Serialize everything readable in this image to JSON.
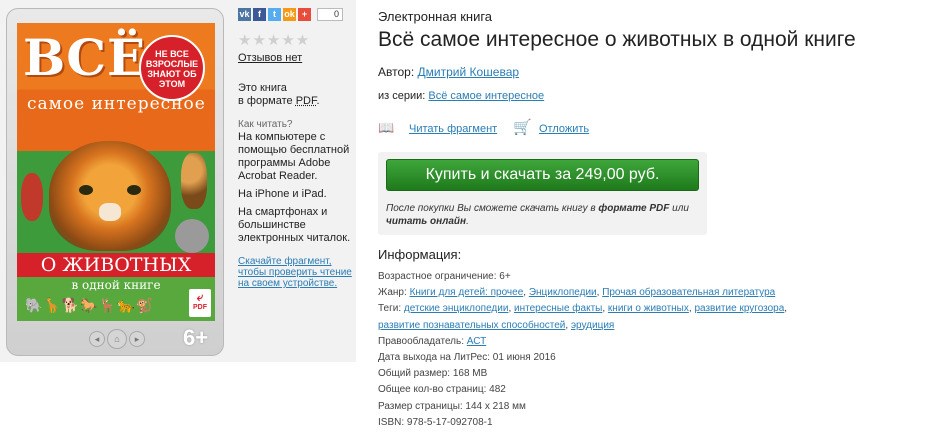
{
  "cover": {
    "title_big": "ВСЁ",
    "title_small": "самое интересное",
    "badge": "НЕ ВСЕ ВЗРОСЛЫЕ ЗНАЮТ ОБ ЭТОМ",
    "red_bar": "О ЖИВОТНЫХ",
    "sub_line": "в одной книге",
    "age_rating": "6+",
    "pdf_label": "PDF"
  },
  "share": {
    "icons": [
      "vk-icon",
      "facebook-icon",
      "twitter-icon",
      "odnoklassniki-icon",
      "plus-icon"
    ],
    "colors": [
      "#4c75a3",
      "#3b5998",
      "#55acee",
      "#f59a16",
      "#e74c3c"
    ],
    "letters": [
      "vk",
      "f",
      "t",
      "ok",
      "+"
    ],
    "count": "0"
  },
  "rating": {
    "stars": "★★★★★",
    "reviews": "Отзывов нет"
  },
  "format": {
    "line1": "Это книга",
    "line2_prefix": "в формате ",
    "line2_pdf": "PDF",
    "line2_suffix": "."
  },
  "howto": {
    "label": "Как читать?",
    "items": [
      "На компьютере с помощью бесплатной программы Adobe Acrobat Reader.",
      "На iPhone и iPad.",
      "На смартфонах и большинстве электронных читалок."
    ],
    "fragment_link": "Скачайте фрагмент, чтобы проверить чтение на своем устройстве."
  },
  "book": {
    "type": "Электронная книга",
    "title": "Всё самое интересное о животных в одной книге",
    "author_label": "Автор: ",
    "author": "Дмитрий Кошевар",
    "series_label": "из серии: ",
    "series": "Всё самое интересное"
  },
  "actions": {
    "read": "Читать фрагмент",
    "defer": "Отложить"
  },
  "buy": {
    "button": "Купить и скачать за 249,00 руб.",
    "note_prefix": "После покупки Вы сможете скачать книгу в ",
    "note_bold1": "формате PDF",
    "note_mid": " или ",
    "note_bold2": "читать онлайн",
    "note_suffix": "."
  },
  "info": {
    "title": "Информация:",
    "age_label": "Возрастное ограничение: ",
    "age": "6+",
    "genre_label": "Жанр: ",
    "genres": [
      "Книги для детей: прочее",
      "Энциклопедии",
      "Прочая образовательная литература"
    ],
    "tags_label": "Теги: ",
    "tags": [
      "детские энциклопедии",
      "интересные факты",
      "книги о животных",
      "развитие кругозора",
      "развитие познавательных способностей",
      "эрудиция"
    ],
    "rights_label": "Правообладатель: ",
    "rights": "АСТ",
    "release": "Дата выхода на ЛитРес: 01 июня 2016",
    "size": "Общий размер: 168 MB",
    "pages": "Общее кол-во страниц: 482",
    "page_size": "Размер страницы: 144 x 218 мм",
    "isbn": "ISBN: 978-5-17-092708-1"
  }
}
